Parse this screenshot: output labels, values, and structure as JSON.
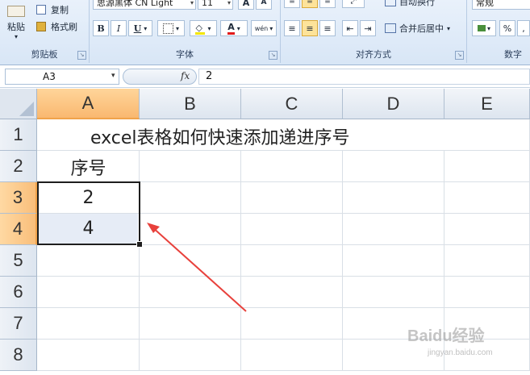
{
  "ribbon": {
    "clipboard": {
      "paste_label": "粘贴",
      "copy_label": "复制",
      "format_painter_label": "格式刷",
      "group_label": "剪贴板"
    },
    "font": {
      "font_name": "思源黑体 CN Light",
      "font_size": "11",
      "bold": "B",
      "italic": "I",
      "underline": "U",
      "grow_font": "A",
      "shrink_font": "A",
      "font_color_glyph": "A",
      "phonetic_glyph": "wén",
      "group_label": "字体"
    },
    "alignment": {
      "wrap_text_label": "自动换行",
      "merge_center_label": "合并后居中",
      "group_label": "对齐方式"
    },
    "number": {
      "format_value": "常规",
      "percent": "%",
      "comma": ",",
      "group_label": "数字"
    }
  },
  "formula_bar": {
    "name_box": "A3",
    "fx": "fx",
    "formula": "2"
  },
  "sheet": {
    "columns": [
      "A",
      "B",
      "C",
      "D",
      "E"
    ],
    "rows": [
      "1",
      "2",
      "3",
      "4",
      "5",
      "6",
      "7",
      "8"
    ],
    "title": "excel表格如何快速添加递进序号",
    "header_cell": "序号",
    "values": [
      "2",
      "4"
    ]
  },
  "watermark": {
    "brand": "Baidu经验",
    "url": "jingyan.baidu.com"
  },
  "colors": {
    "selected_header": "#f9b870",
    "arrow": "#e8413c",
    "selection_border": "#1e1e1e"
  }
}
